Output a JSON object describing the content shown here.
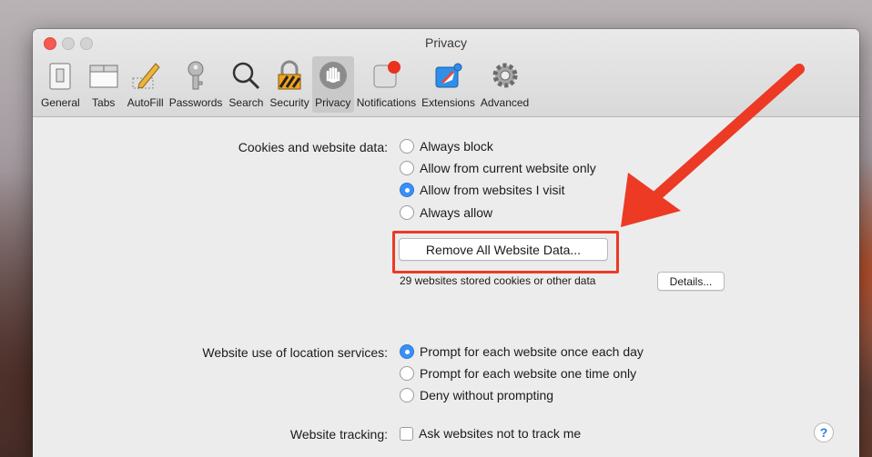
{
  "window": {
    "title": "Privacy"
  },
  "toolbar": {
    "tabs": [
      {
        "label": "General",
        "icon": "switch-icon"
      },
      {
        "label": "Tabs",
        "icon": "tabs-icon"
      },
      {
        "label": "AutoFill",
        "icon": "pencil-icon"
      },
      {
        "label": "Passwords",
        "icon": "key-icon"
      },
      {
        "label": "Search",
        "icon": "magnifier-icon"
      },
      {
        "label": "Security",
        "icon": "padlock-icon"
      },
      {
        "label": "Privacy",
        "icon": "hand-icon",
        "active": true
      },
      {
        "label": "Notifications",
        "icon": "notification-badge-icon"
      },
      {
        "label": "Extensions",
        "icon": "puzzle-icon"
      },
      {
        "label": "Advanced",
        "icon": "gear-icon"
      }
    ]
  },
  "cookies": {
    "label": "Cookies and website data:",
    "options": [
      {
        "label": "Always block",
        "selected": false
      },
      {
        "label": "Allow from current website only",
        "selected": false
      },
      {
        "label": "Allow from websites I visit",
        "selected": true
      },
      {
        "label": "Always allow",
        "selected": false
      }
    ],
    "remove_button": "Remove All Website Data...",
    "stored_text": "29 websites stored cookies or other data",
    "details_button": "Details..."
  },
  "location": {
    "label": "Website use of location services:",
    "options": [
      {
        "label": "Prompt for each website once each day",
        "selected": true
      },
      {
        "label": "Prompt for each website one time only",
        "selected": false
      },
      {
        "label": "Deny without prompting",
        "selected": false
      }
    ]
  },
  "tracking": {
    "label": "Website tracking:",
    "checkbox_label": "Ask websites not to track me",
    "checked": false
  },
  "help": {
    "symbol": "?"
  },
  "colors": {
    "accent": "#3a8ff7",
    "annotation": "#ec3a25"
  }
}
